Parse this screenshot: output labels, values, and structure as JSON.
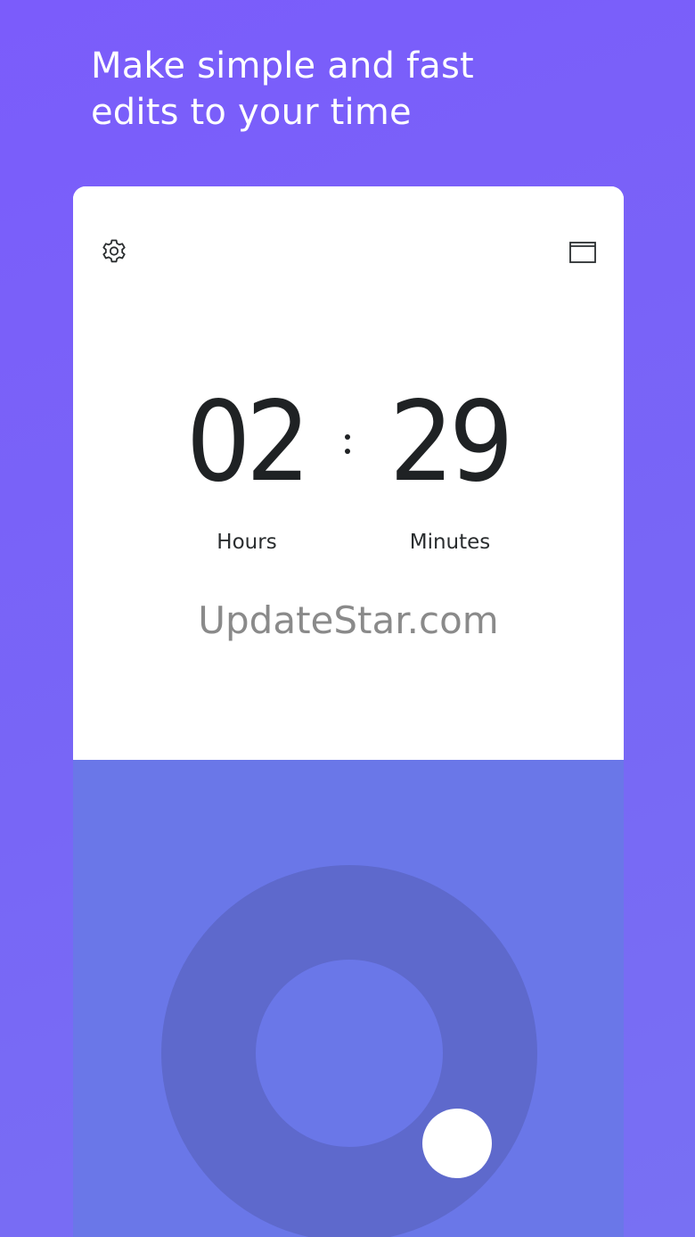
{
  "header": {
    "line1": "Make simple and fast",
    "line2": "edits to your time"
  },
  "card": {
    "icons": {
      "settings": "gear-icon",
      "window": "window-icon"
    },
    "time": {
      "hours": "02",
      "minutes": "29"
    },
    "labels": {
      "hours": "Hours",
      "minutes": "Minutes"
    },
    "watermark": "UpdateStar.com"
  },
  "colors": {
    "background": "#7b5cfb",
    "card": "#ffffff",
    "panel": "#6a77e8",
    "dial_ring": "#5e69cc",
    "knob": "#ffffff",
    "digits": "#1f2224"
  }
}
